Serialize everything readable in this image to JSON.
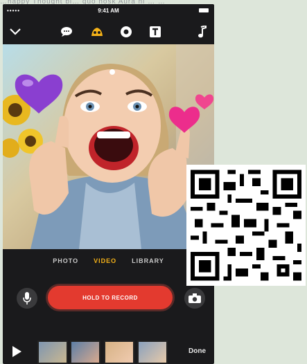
{
  "caption": "…happy Thought bi… quo hosk Aura hi … …",
  "status": {
    "carrier": "•••••",
    "time": "9:41 AM"
  },
  "toolbar": {
    "icons": [
      "chevron-down-icon",
      "speech-bubble-icon",
      "effects-icon",
      "sticker-icon",
      "text-icon",
      "music-icon"
    ],
    "accent": "#f6b318"
  },
  "modes": {
    "photo": "PHOTO",
    "video": "VIDEO",
    "library": "LIBRARY",
    "active": "VIDEO"
  },
  "record": {
    "label": "HOLD TO RECORD",
    "color": "#e33a2f"
  },
  "filmstrip": {
    "done": "Done",
    "thumb_count": 4
  }
}
